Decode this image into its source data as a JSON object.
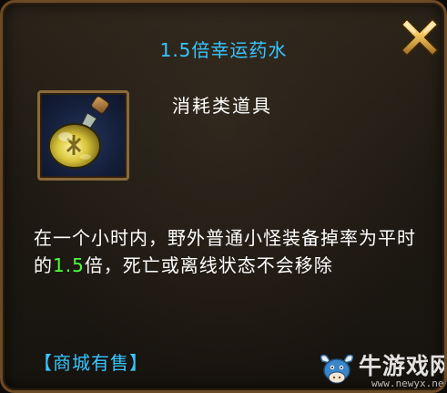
{
  "dialog": {
    "title": "1.5倍幸运药水",
    "item_type": "消耗类道具",
    "description": {
      "part1": "在一个小时内，野外普通小怪装备掉率为平时的",
      "highlight": "1.5",
      "part2": "倍，死亡或离线状态不会移除"
    },
    "shop_tag": "【商城有售】",
    "close_icon": "close-x-icon",
    "item_icon": "potion-bottle-icon"
  },
  "watermark": {
    "text": "牛游戏网",
    "url": "www.newyx.net"
  },
  "colors": {
    "title": "#37c6ff",
    "highlight": "#4cff3c",
    "text": "#ffffff",
    "frame": "#8a6a3a"
  }
}
